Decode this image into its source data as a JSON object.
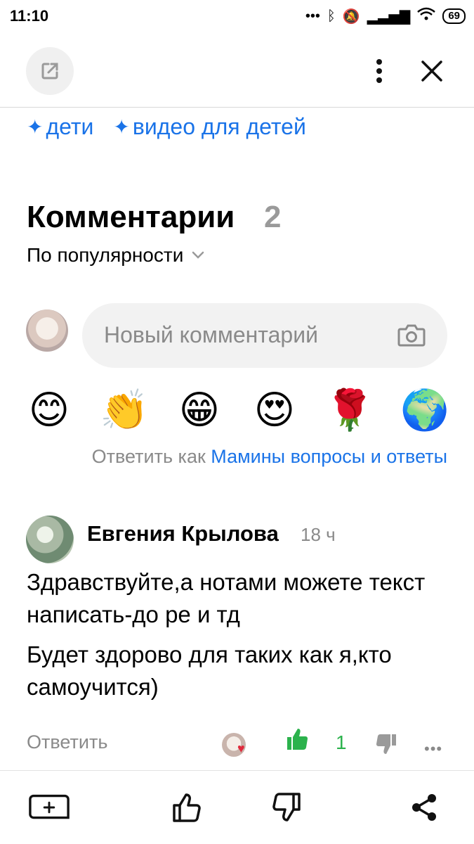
{
  "status": {
    "time": "11:10",
    "battery": "69"
  },
  "tags": [
    {
      "icon": "✦",
      "label": "дети"
    },
    {
      "icon": "✦",
      "label": "видео для детей"
    }
  ],
  "comments_section": {
    "title": "Комментарии",
    "count": "2",
    "sort_label": "По популярности",
    "input_placeholder": "Новый комментарий",
    "emojis": [
      "😊",
      "👏",
      "😁",
      "😍",
      "🌹",
      "🌍"
    ],
    "reply_as_prefix": "Ответить как ",
    "reply_as_name": "Мамины вопросы и ответы"
  },
  "comment": {
    "author": "Евгения Крылова",
    "time": "18 ч",
    "paragraphs": [
      "Здравствуйте,а нотами можете текст написать-до ре и тд",
      "Будет здорово для таких как я,кто самоучится)"
    ],
    "reply_label": "Ответить",
    "like_count": "1"
  },
  "colors": {
    "accent": "#1a73e8",
    "like_green": "#2bb24c",
    "muted": "#8a8a8a"
  }
}
